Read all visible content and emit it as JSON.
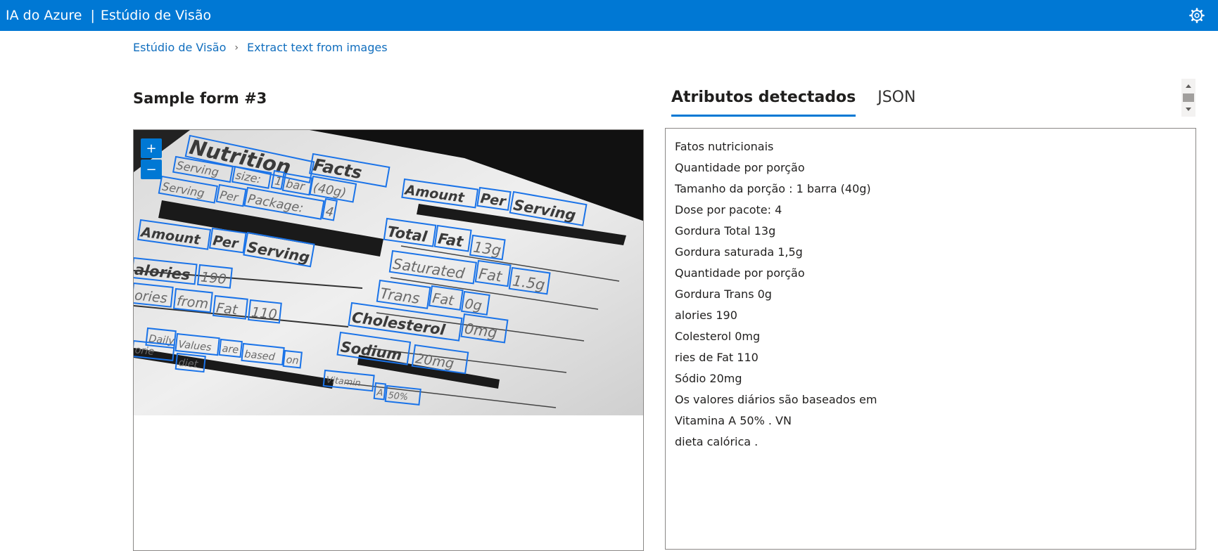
{
  "header": {
    "product": "IA do Azure",
    "separator": "|",
    "app": "Estúdio de Visão",
    "settings_icon": "gear-icon"
  },
  "breadcrumb": {
    "root": "Estúdio de Visão",
    "current": "Extract text from images"
  },
  "sample": {
    "title": "Sample form #3",
    "zoom_in": "+",
    "zoom_out": "−"
  },
  "tabs": [
    {
      "label": "Atributos detectados",
      "active": true
    },
    {
      "label": "JSON",
      "active": false
    }
  ],
  "image_words": [
    "Nutrition",
    "Facts",
    "Serving",
    "size:",
    "1",
    "bar",
    "(40g)",
    "Serving",
    "Per",
    "Package:",
    "4",
    "Amount",
    "Per",
    "Serving",
    "Amount",
    "Per",
    "Serving",
    "alories",
    "190",
    "Total",
    "Fat",
    "13g",
    "Saturated",
    "Fat",
    "1.5g",
    "ories",
    "from",
    "Fat",
    "110",
    "Trans",
    "Fat",
    "0g",
    "Cholesterol",
    "0mg",
    "Daily",
    "Values",
    "are",
    "based",
    "on",
    "orie",
    "diet",
    "Sodium",
    "20mg",
    "Vitamin",
    "A",
    "50%"
  ],
  "detected_lines": [
    "Fatos nutricionais",
    "Quantidade por porção",
    "Tamanho da porção : 1 barra (40g)",
    "Dose por pacote: 4",
    "Gordura Total 13g",
    "Gordura saturada 1,5g",
    "Quantidade por porção",
    "Gordura Trans 0g",
    "alories 190",
    "Colesterol 0mg",
    "ries de Fat 110",
    "Sódio 20mg",
    "Os valores diários são baseados em",
    "Vitamina A 50% . VN",
    "dieta calórica ."
  ],
  "colors": {
    "accent": "#0078d4",
    "box": "#1a73e8"
  }
}
